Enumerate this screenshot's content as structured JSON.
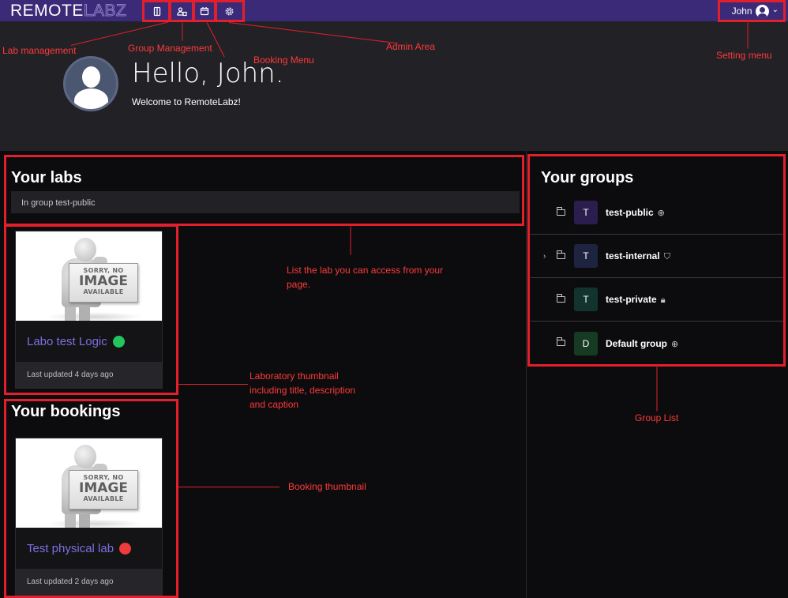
{
  "navbar": {
    "brand": "REMOTE",
    "brand_b": "LABZ",
    "icons": [
      "lab-icon",
      "group-icon",
      "calendar-icon",
      "gear-icon"
    ],
    "user_name": "John",
    "user_caret": "⌄"
  },
  "hero": {
    "title": "Hello, John.",
    "subtitle": "Welcome to RemoteLabz!"
  },
  "labs": {
    "title": "Your labs",
    "group_label": "In group test-public",
    "card": {
      "title": "Labo test Logic",
      "status_color": "#22c55e",
      "footer": "Last updated 4 days ago"
    }
  },
  "bookings": {
    "title": "Your bookings",
    "card": {
      "title": "Test physical lab",
      "status_color": "#ef3b3b",
      "footer": "Last updated 2 days ago"
    }
  },
  "placeholder": {
    "line1": "SORRY, NO",
    "line2": "IMAGE",
    "line3": "AVAILABLE"
  },
  "groups": {
    "title": "Your groups",
    "items": [
      {
        "initial": "T",
        "name": "test-public",
        "visibility_icon": "globe-icon",
        "badge_color": "#2b1e4e",
        "has_children": false
      },
      {
        "initial": "T",
        "name": "test-internal",
        "visibility_icon": "shield-icon",
        "badge_color": "#1e2440",
        "has_children": true
      },
      {
        "initial": "T",
        "name": "test-private",
        "visibility_icon": "lock-icon",
        "badge_color": "#13342e",
        "has_children": false
      },
      {
        "initial": "D",
        "name": "Default group",
        "visibility_icon": "globe-icon",
        "badge_color": "#173a22",
        "has_children": false
      }
    ]
  },
  "annotations": {
    "lab_management": "Lab management",
    "group_management": "Group Management",
    "booking_menu": "Booking Menu",
    "admin_area": "Admin Area",
    "setting_menu": "Setting menu",
    "list_labs": "List the lab you can access from your page.",
    "lab_thumbnail": "Laboratory thumbnail including title, description and caption",
    "group_list": "Group List",
    "booking_thumbnail": "Booking thumbnail"
  }
}
